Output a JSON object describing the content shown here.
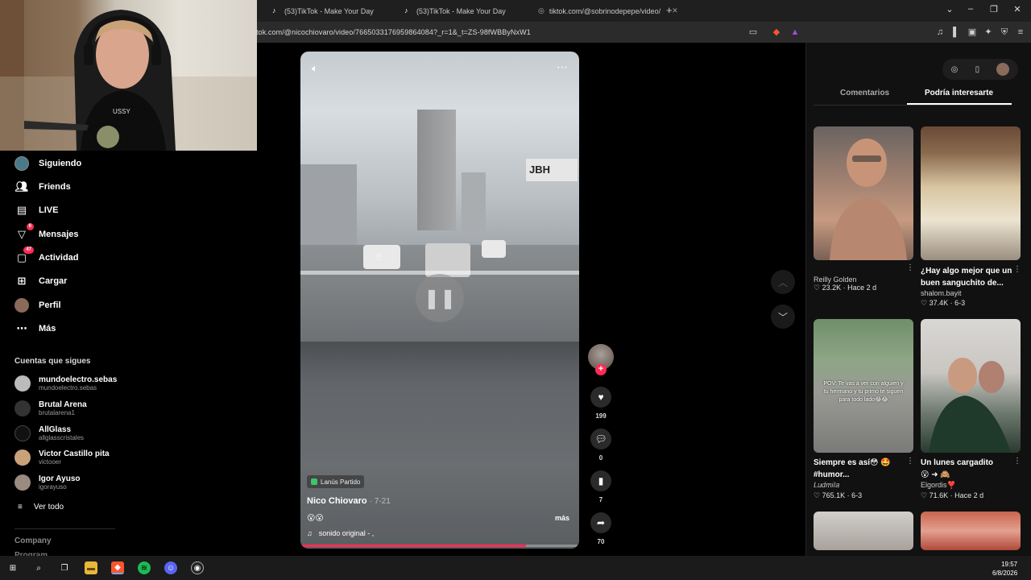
{
  "browser": {
    "tabs": [
      {
        "title": "(53)TikTok - Make Your Day"
      },
      {
        "title": "(53)TikTok - Make Your Day"
      },
      {
        "title": "tiktok.com/@sobrinodepepe/video/"
      }
    ],
    "url": "tok.com/@nicochiovaro/video/7665033176959864084?_r=1&_t=ZS-98fWBByNxW1",
    "new_tab_symbol": "+"
  },
  "sidebar": {
    "nav": [
      {
        "label": "Siguiendo",
        "icon": "following-avatar-icon"
      },
      {
        "label": "Friends",
        "icon": "friends-icon"
      },
      {
        "label": "LIVE",
        "icon": "live-icon"
      },
      {
        "label": "Mensajes",
        "icon": "messages-icon",
        "badge": "6"
      },
      {
        "label": "Actividad",
        "icon": "activity-icon",
        "badge": "47"
      },
      {
        "label": "Cargar",
        "icon": "upload-icon"
      },
      {
        "label": "Perfil",
        "icon": "profile-icon"
      },
      {
        "label": "Más",
        "icon": "more-icon"
      }
    ],
    "following_title": "Cuentas que sigues",
    "accounts": [
      {
        "name": "mundoelectro.sebas",
        "handle": "mundoelectro.sebas"
      },
      {
        "name": "Brutal Arena",
        "handle": "brutalarena1"
      },
      {
        "name": "AllGlass",
        "handle": "allglasscristales"
      },
      {
        "name": "Victor Castillo pita",
        "handle": "victooer"
      },
      {
        "name": "Igor Ayuso",
        "handle": "igorayuso"
      }
    ],
    "see_all": "Ver todo",
    "company": "Company",
    "program": "Program"
  },
  "video": {
    "tag": "Lanús Partido",
    "author": "Nico Chiovaro",
    "date": "· 7-21",
    "caption": "😮😮",
    "more": "más",
    "sound": "sonido original - ,",
    "progress": 0.81,
    "sign_text": "JBH"
  },
  "actions": {
    "likes": "199",
    "comments": "0",
    "saves": "7",
    "shares": "70"
  },
  "panel": {
    "tabs": [
      "Comentarios",
      "Podría interesarte"
    ],
    "active_tab": "Podría interesarte",
    "suggestions": [
      {
        "title": "",
        "user": "Reilly Golden",
        "likes": "23.2K",
        "date": "Hace 2 d"
      },
      {
        "title": "¿Hay algo mejor que un buen sanguchito de...",
        "user": "shalom.bayit",
        "likes": "37.4K",
        "date": "6-3"
      },
      {
        "title": "Siempre es así😳 🤩 #humor...",
        "user": "𝐿𝑢𝑑𝑚𝑖𝑙𝑎",
        "likes": "765.1K",
        "date": "6-3",
        "overlay": "POV: Te vas a ver con alguien y tu hermano y tu primo te siguen para todo lado😂😂"
      },
      {
        "title": "Un lunes cargadito",
        "user": "Elgordis❣️",
        "likes": "71.6K",
        "date": "Hace 2 d"
      }
    ]
  },
  "taskbar": {
    "time": "19:57",
    "date": "6/8/2026"
  }
}
